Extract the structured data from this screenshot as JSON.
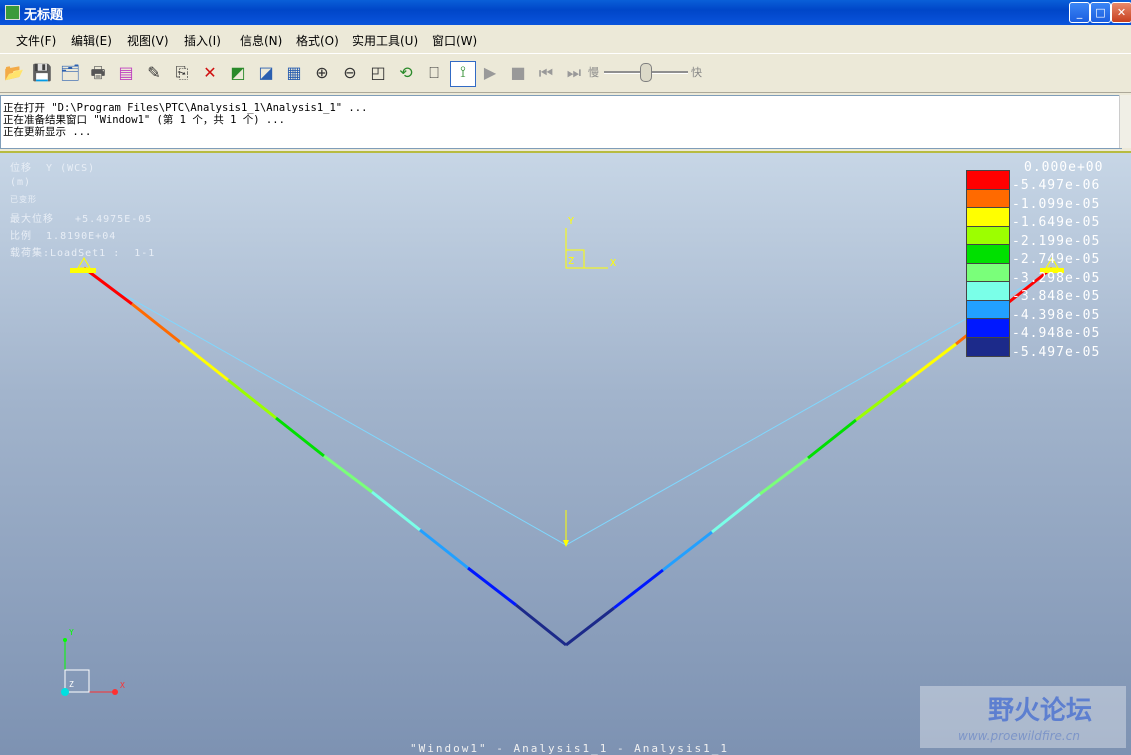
{
  "window": {
    "title": "无标题",
    "minimize": "_",
    "maximize": "□",
    "close": "✕"
  },
  "menu": [
    {
      "label": "文件(F)"
    },
    {
      "label": "编辑(E)"
    },
    {
      "label": "视图(V)"
    },
    {
      "label": "插入(I)"
    },
    {
      "label": "信息(N)"
    },
    {
      "label": "格式(O)"
    },
    {
      "label": "实用工具(U)"
    },
    {
      "label": "窗口(W)"
    }
  ],
  "toolbar": {
    "slider_slow": "慢",
    "slider_fast": "快",
    "icons": [
      "open-icon",
      "save-icon",
      "save-as-icon",
      "print-icon",
      "display-icon",
      "edit-icon",
      "copy-icon",
      "delete-icon",
      "show-icon",
      "hide-icon",
      "format-icon",
      "zoom-in-icon",
      "zoom-out-icon",
      "refit-icon",
      "spin-icon",
      "label-icon",
      "query-icon",
      "play-icon",
      "stop-icon",
      "step-back-icon",
      "step-forward-icon"
    ]
  },
  "messages": [
    "正在打开 \"D:\\Program Files\\PTC\\Analysis1_1\\Analysis1_1\" ...",
    "正在准备结果窗口 \"Window1\" (第 1 个，共 1 个) ...",
    "正在更新显示 ..."
  ],
  "viewport": {
    "info": {
      "l1": "位移  Y (WCS)",
      "l2": "(m)",
      "l3": "已变形",
      "l4": "最大位移   +5.4975E-05",
      "l5": "比例  1.8190E+04",
      "l6": "载荷集:LoadSet1 :  1-1"
    },
    "axis_y": "Y",
    "axis_x": "X",
    "axis_z": "Z",
    "legend": {
      "top": "0.000e+00",
      "labels": [
        "-5.497e-06",
        "-1.099e-05",
        "-1.649e-05",
        "-2.199e-05",
        "-2.749e-05",
        "-3.298e-05",
        "-3.848e-05",
        "-4.398e-05",
        "-4.948e-05",
        "-5.497e-05"
      ],
      "colors": [
        "#ff0000",
        "#ff6a00",
        "#ffff00",
        "#9cff00",
        "#00e000",
        "#7aff7a",
        "#7affe8",
        "#22a0ff",
        "#0018ff",
        "#1c2a8a"
      ]
    },
    "footer": "\"Window1\" - Analysis1_1 - Analysis1_1"
  },
  "watermark": {
    "title": "野火论坛",
    "url": "www.proewildfire.cn"
  }
}
